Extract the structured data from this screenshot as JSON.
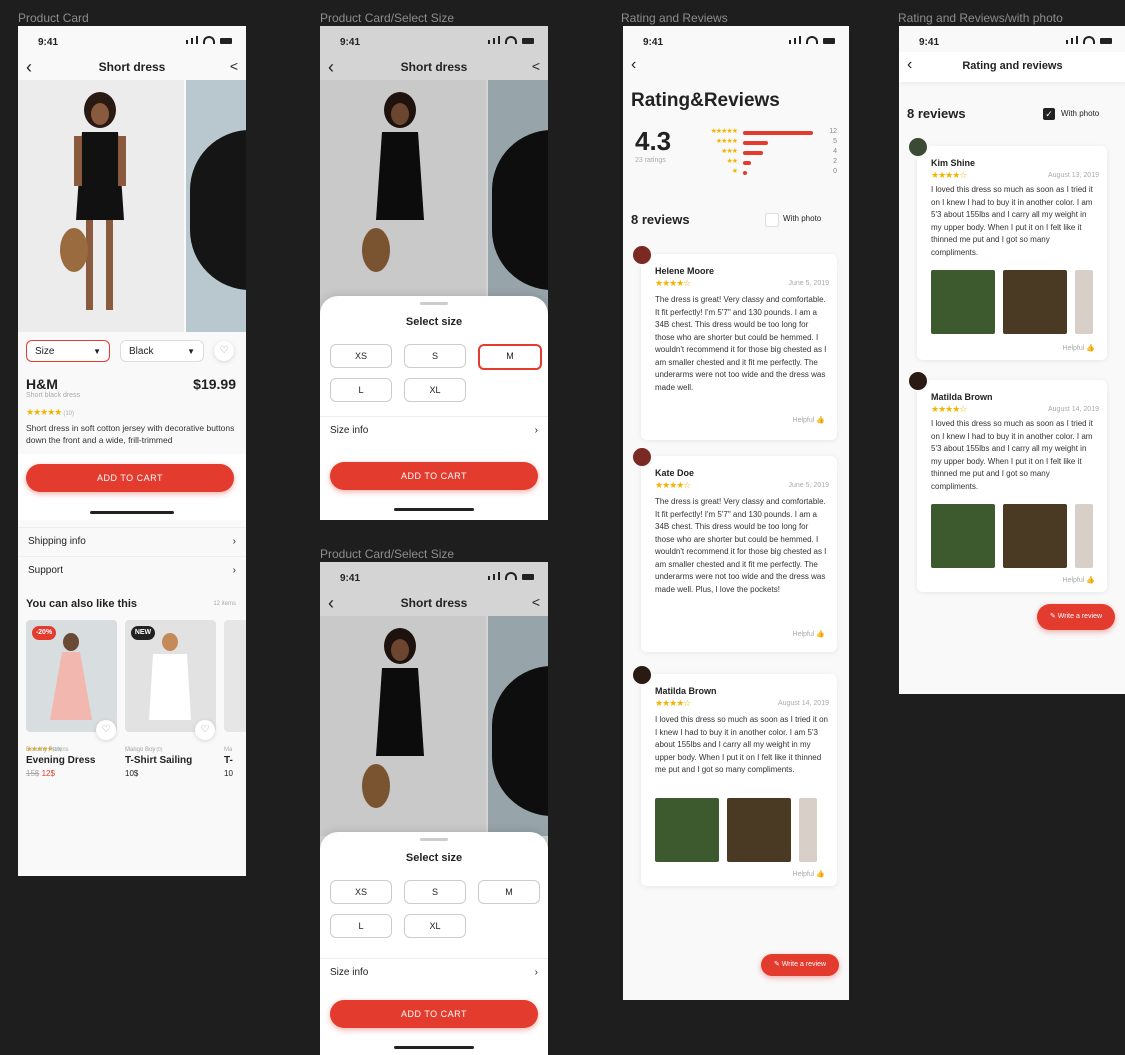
{
  "frame_labels": {
    "product_card": "Product Card",
    "select_size_1": "Product Card/Select Size",
    "select_size_2": "Product Card/Select Size",
    "ratings": "Rating and Reviews",
    "ratings_photo": "Rating and Reviews/with photo"
  },
  "status_time": "9:41",
  "product": {
    "nav_title": "Short dress",
    "size_select": "Size",
    "color_select": "Black",
    "brand": "H&M",
    "subtitle": "Short black dress",
    "price": "$19.99",
    "rating_count": "(10)",
    "description": "Short dress in soft cotton jersey with decorative buttons down the front and a wide, frill-trimmed",
    "add_to_cart": "ADD TO CART",
    "shipping": "Shipping info",
    "support": "Support",
    "also_like": "You can also like this",
    "items_count": "12 items",
    "items": [
      {
        "badge": "-20%",
        "rating": "(10)",
        "brand": "Dorothy Perkins",
        "name": "Evening Dress",
        "old_price": "15$",
        "price": "12$"
      },
      {
        "badge": "NEW",
        "rating": "(0)",
        "brand": "Mango Boy",
        "name": "T-Shirt Sailing",
        "price": "10$"
      },
      {
        "brand": "Ma",
        "name": "T-",
        "price": "10"
      }
    ]
  },
  "size_sheet": {
    "title": "Select size",
    "sizes": [
      "XS",
      "S",
      "M",
      "L",
      "XL"
    ],
    "selected": "M",
    "size_info": "Size info",
    "add_to_cart": "ADD TO CART"
  },
  "ratings": {
    "heading": "Rating&Reviews",
    "average": "4.3",
    "ratings_count": "23 ratings",
    "distribution": [
      {
        "stars": "★★★★★",
        "count": "12",
        "fraction": 1.0
      },
      {
        "stars": "★★★★",
        "count": "5",
        "fraction": 0.35
      },
      {
        "stars": "★★★",
        "count": "4",
        "fraction": 0.28
      },
      {
        "stars": "★★",
        "count": "2",
        "fraction": 0.12
      },
      {
        "stars": "★",
        "count": "0",
        "fraction": 0.03
      }
    ],
    "reviews_title": "8 reviews",
    "with_photo": "With photo",
    "helpful": "Helpful",
    "write_review": "Write a review",
    "reviews": [
      {
        "name": "Helene Moore",
        "stars": "★★★★☆",
        "date": "June 5, 2019",
        "text": "The dress is great! Very classy and comfortable. It fit perfectly! I'm 5'7\" and 130 pounds. I am a 34B chest. This dress would be too long for those who are shorter but could be hemmed. I wouldn't recommend it for those big chested as I am smaller chested and it fit me perfectly. The underarms were not too wide and the dress was made well."
      },
      {
        "name": "Kate Doe",
        "stars": "★★★★☆",
        "date": "June 5, 2019",
        "text": "The dress is great! Very classy and comfortable. It fit perfectly! I'm 5'7\" and 130 pounds. I am a 34B chest. This dress would be too long for those who are shorter but could be hemmed. I wouldn't recommend it for those big chested as I am smaller chested and it fit me perfectly. The underarms were not too wide and the dress was made well. Plus, I love the pockets!"
      },
      {
        "name": "Matilda Brown",
        "stars": "★★★★☆",
        "date": "August 14, 2019",
        "text": "I loved this dress so much as soon as I tried it on I knew I had to buy it in another color. I am 5'3 about 155lbs and I carry all my weight in my upper body. When I put it on I felt like it thinned me put and I got so many compliments."
      }
    ]
  },
  "ratings_photo": {
    "nav_title": "Rating and reviews",
    "reviews_title": "8 reviews",
    "with_photo": "With photo",
    "helpful": "Helpful",
    "write_review": "Write a review",
    "reviews": [
      {
        "name": "Kim Shine",
        "stars": "★★★★☆",
        "date": "August 13, 2019",
        "text": "I loved this dress so much as soon as I tried it on I knew I had to buy it in another color. I am 5'3 about 155lbs and I carry all my weight in my upper body. When I put it on I felt like it thinned me put and I got so many compliments."
      },
      {
        "name": "Matilda Brown",
        "stars": "★★★★☆",
        "date": "August 14, 2019",
        "text": "I loved this dress so much as soon as I tried it on I knew I had to buy it in another color. I am 5'3 about 155lbs and I carry all my weight in my upper body. When I put it on I felt like it thinned me put and I got so many compliments."
      }
    ]
  },
  "colors": {
    "accent": "#e33b2e",
    "star": "#f5b301",
    "background": "#1e1e1e",
    "frame": "#f9f9f9"
  }
}
